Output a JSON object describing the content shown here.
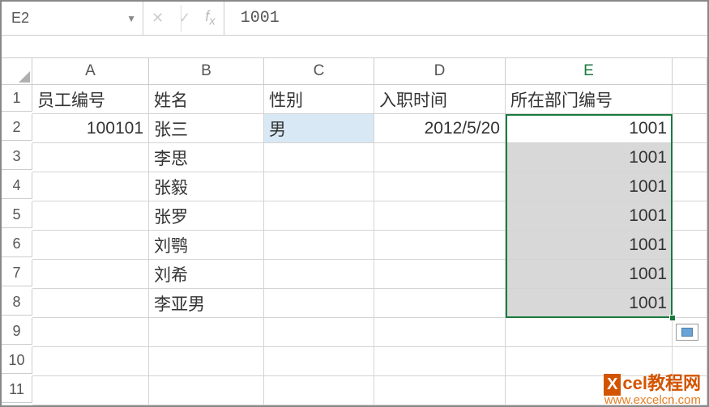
{
  "name_box": "E2",
  "formula_value": "1001",
  "columns": [
    "A",
    "B",
    "C",
    "D",
    "E"
  ],
  "active_column": "E",
  "rows": [
    {
      "n": "1",
      "A": "员工编号",
      "B": "姓名",
      "C": "性别",
      "D": "入职时间",
      "E": "所在部门编号"
    },
    {
      "n": "2",
      "A": "100101",
      "B": "张三",
      "C": "男",
      "D": "2012/5/20",
      "E": "1001"
    },
    {
      "n": "3",
      "A": "",
      "B": "李思",
      "C": "",
      "D": "",
      "E": "1001"
    },
    {
      "n": "4",
      "A": "",
      "B": "张毅",
      "C": "",
      "D": "",
      "E": "1001"
    },
    {
      "n": "5",
      "A": "",
      "B": "张罗",
      "C": "",
      "D": "",
      "E": "1001"
    },
    {
      "n": "6",
      "A": "",
      "B": "刘鹗",
      "C": "",
      "D": "",
      "E": "1001"
    },
    {
      "n": "7",
      "A": "",
      "B": "刘希",
      "C": "",
      "D": "",
      "E": "1001"
    },
    {
      "n": "8",
      "A": "",
      "B": "李亚男",
      "C": "",
      "D": "",
      "E": "1001"
    },
    {
      "n": "9",
      "A": "",
      "B": "",
      "C": "",
      "D": "",
      "E": ""
    },
    {
      "n": "10",
      "A": "",
      "B": "",
      "C": "",
      "D": "",
      "E": ""
    },
    {
      "n": "11",
      "A": "",
      "B": "",
      "C": "",
      "D": "",
      "E": ""
    }
  ],
  "watermark": {
    "logo_letter": "X",
    "text": "cel教程网",
    "url": "www.excelcn.com"
  }
}
